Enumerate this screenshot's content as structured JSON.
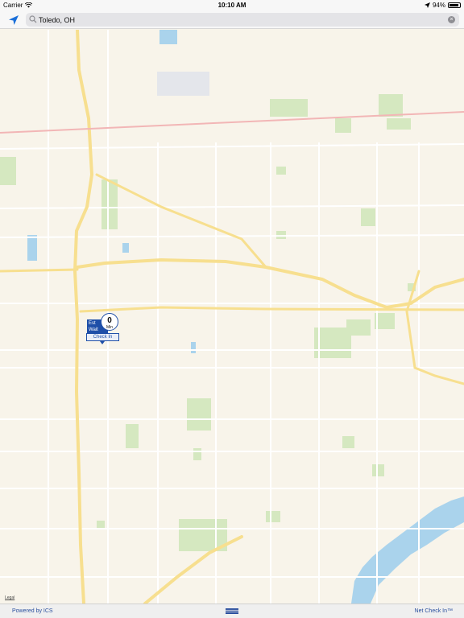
{
  "status_bar": {
    "carrier": "Carrier",
    "time": "10:10 AM",
    "battery": "94%",
    "icons": [
      "wifi-icon",
      "location-arrow-icon",
      "battery-icon"
    ]
  },
  "search": {
    "value": "Toledo, OH",
    "placeholder": "",
    "icons": [
      "locate-arrow-icon",
      "search-icon",
      "clear-icon"
    ]
  },
  "map": {
    "legal_label": "Legal",
    "marker": {
      "est_label_line1": "Est",
      "est_label_line2": "Wait",
      "wait_value": "0",
      "wait_unit": "Min",
      "checkin_label": "Check In"
    }
  },
  "bottom_bar": {
    "powered_by": "Powered by ICS",
    "logo": "ics-logo-icon",
    "product": "Net Check In™"
  },
  "colors": {
    "map_background": "#f8f4ea",
    "major_road": "#f7df8f",
    "park": "#d5e8c0",
    "water": "#aad3ec",
    "brand_blue": "#1f4fa8"
  }
}
